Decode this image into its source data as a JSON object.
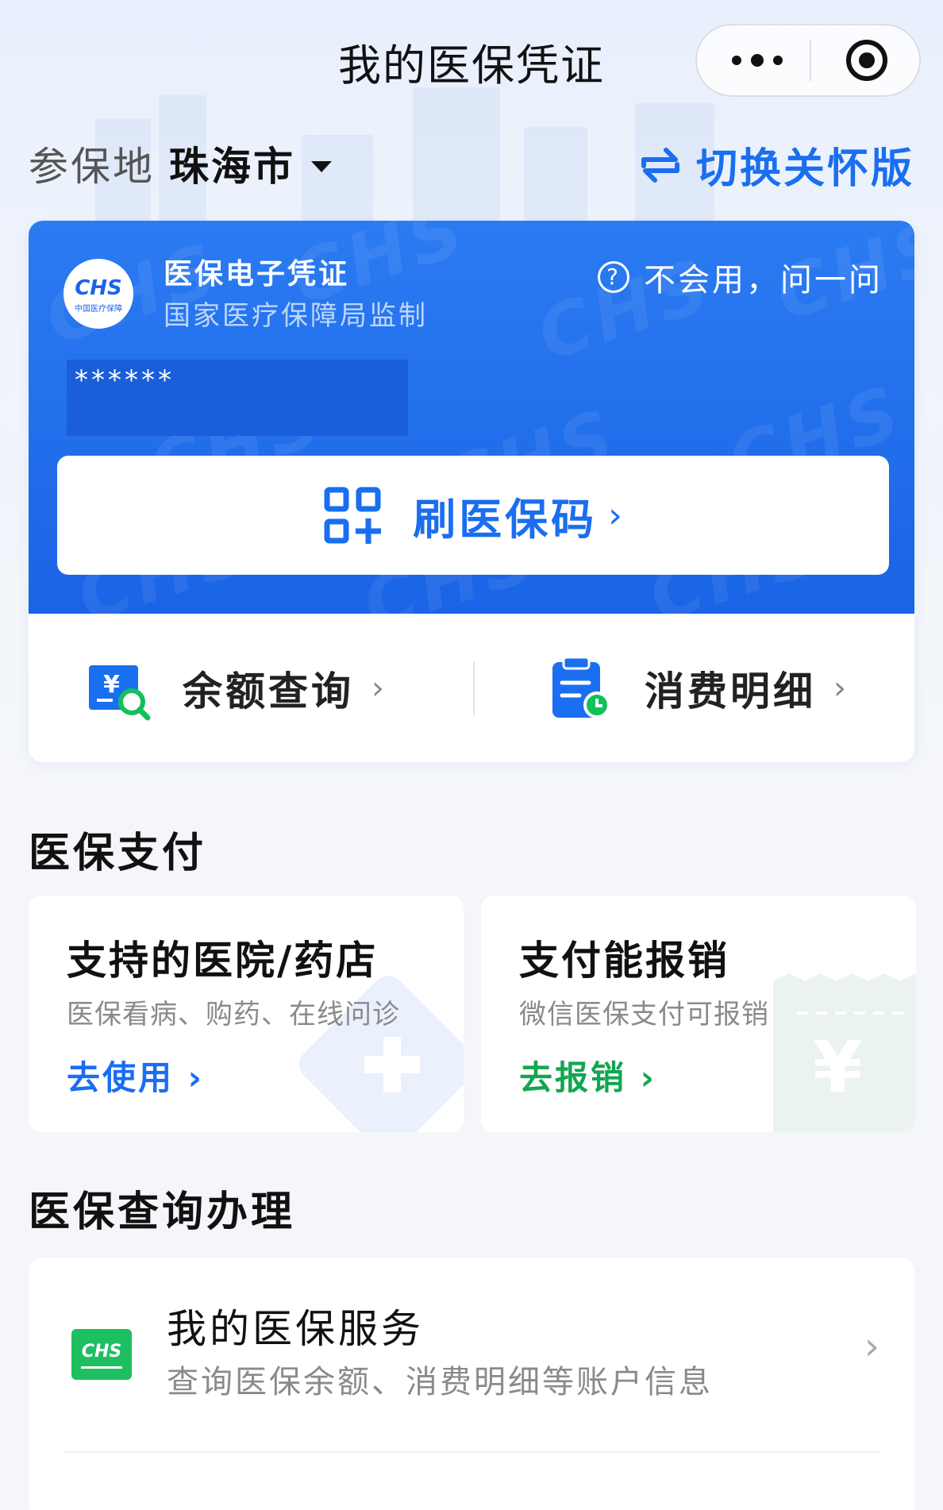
{
  "nav": {
    "title": "我的医保凭证"
  },
  "location": {
    "label": "参保地",
    "city": "珠海市",
    "switch_label": "切换关怀版"
  },
  "card": {
    "logo_text": "CHS",
    "logo_subtext": "中国医疗保障",
    "title": "医保电子凭证",
    "subtitle": "国家医疗保障局监制",
    "help_label": "不会用，问一问",
    "masked_name": "******",
    "scan_label": "刷医保码",
    "watermark": "CHS",
    "actions": [
      {
        "label": "余额查询"
      },
      {
        "label": "消费明细"
      }
    ]
  },
  "payment": {
    "title": "医保支付",
    "cards": [
      {
        "title": "支持的医院/药店",
        "subtitle": "医保看病、购药、在线问诊",
        "link": "去使用",
        "color": "#1a6ef0"
      },
      {
        "title": "支付能报销",
        "subtitle": "微信医保支付可报销",
        "link": "去报销",
        "color": "#13a650"
      }
    ]
  },
  "services": {
    "title": "医保查询办理",
    "items": [
      {
        "logo": "CHS",
        "title": "我的医保服务",
        "subtitle": "查询医保余额、消费明细等账户信息"
      }
    ]
  },
  "colors": {
    "primary": "#1a6ef0",
    "green": "#13a650",
    "card_blue": "#1a64e6"
  },
  "icons": [
    "more-icon",
    "close-icon",
    "switch-icon",
    "help-icon",
    "qr-code-icon",
    "balance-icon",
    "bill-icon",
    "chevron-right-icon",
    "chs-logo"
  ]
}
